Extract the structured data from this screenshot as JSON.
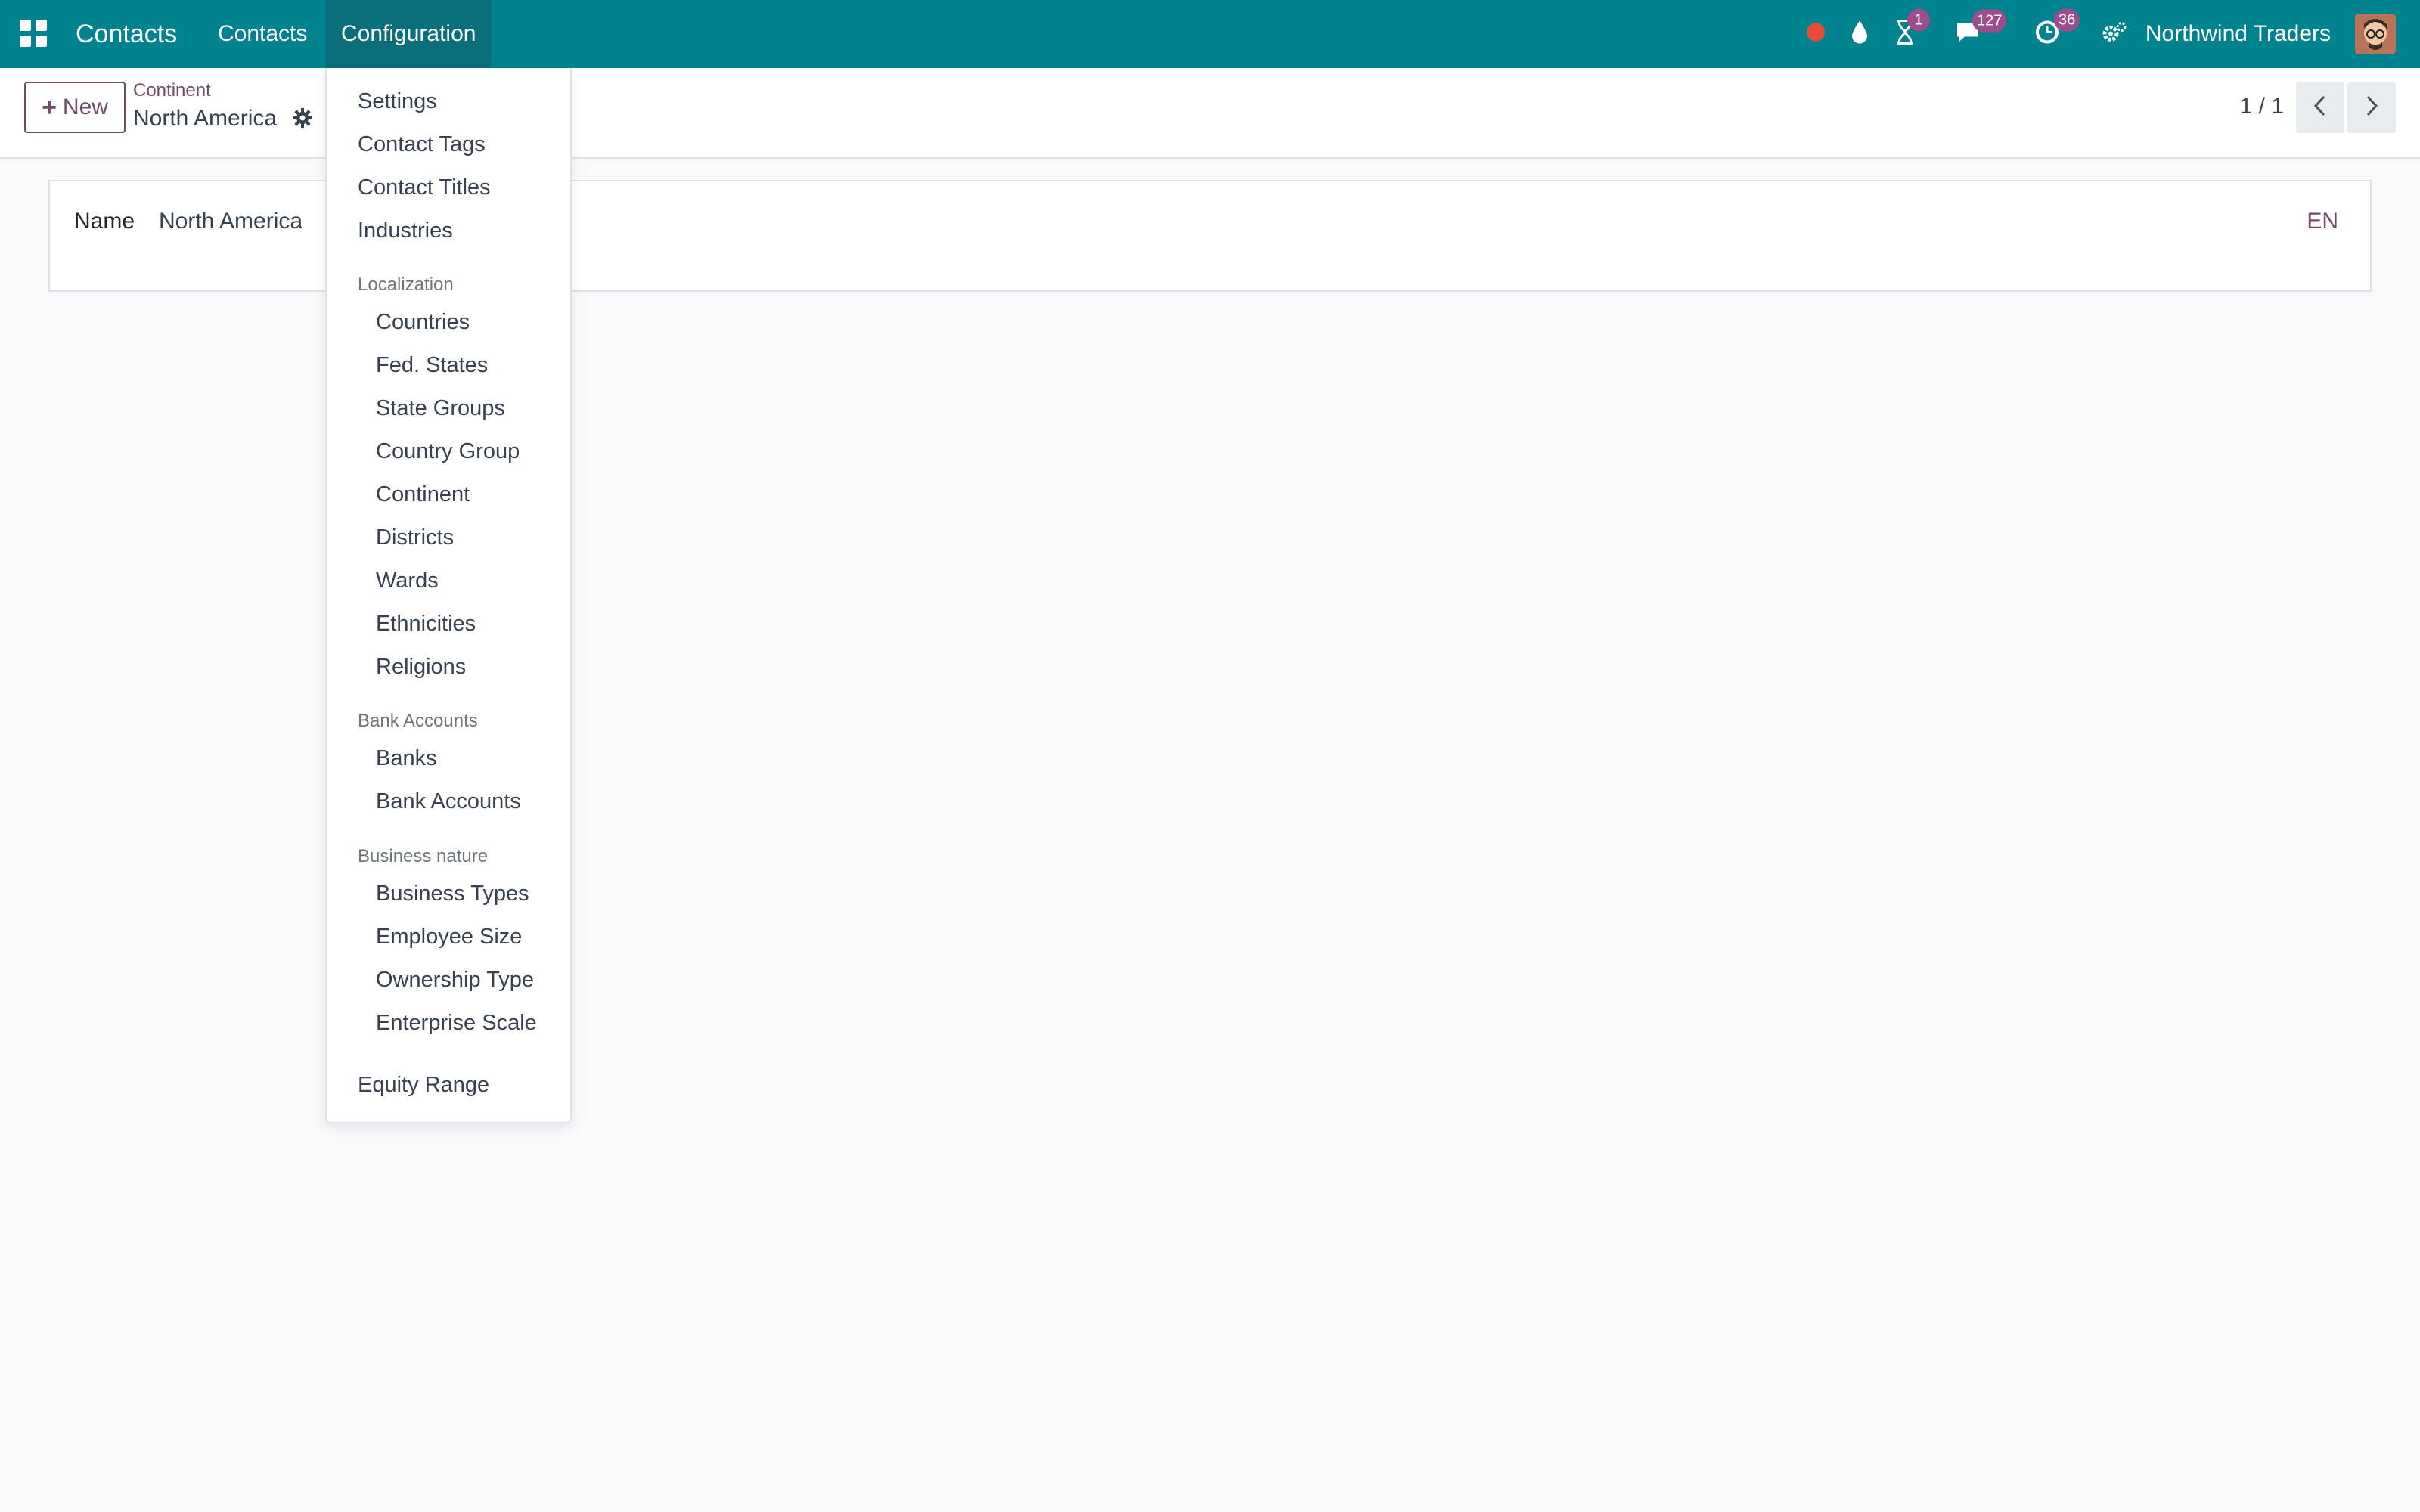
{
  "navbar": {
    "app_name": "Contacts",
    "menus": [
      "Contacts",
      "Configuration"
    ],
    "activity_badge": "1",
    "messages_badge": "127",
    "clock_badge": "36",
    "company": "Northwind Traders",
    "accent_color": "#00838f",
    "badge_color": "#9c4e8c"
  },
  "control_panel": {
    "new_label": "New",
    "breadcrumb_parent": "Continent",
    "breadcrumb_current": "North America",
    "pager_value": "1 / 1"
  },
  "form": {
    "name_label": "Name",
    "name_value": "North America",
    "lang": "EN"
  },
  "dropdown": {
    "items": [
      "Settings",
      "Contact Tags",
      "Contact Titles",
      "Industries"
    ],
    "localization_header": "Localization",
    "localization": [
      "Countries",
      "Fed. States",
      "State Groups",
      "Country Group",
      "Continent",
      "Districts",
      "Wards",
      "Ethnicities",
      "Religions"
    ],
    "bank_header": "Bank Accounts",
    "bank": [
      "Banks",
      "Bank Accounts"
    ],
    "business_header": "Business nature",
    "business": [
      "Business Types",
      "Employee Size",
      "Ownership Type",
      "Enterprise Scale"
    ],
    "last_item": "Equity Range"
  },
  "icons": [
    "apps-grid-icon",
    "record-dot-icon",
    "drop-icon",
    "hourglass-icon",
    "chat-icon",
    "clock-icon",
    "settings-gear-icon",
    "gear-icon",
    "chevron-left-icon",
    "chevron-right-icon",
    "plus-icon"
  ]
}
